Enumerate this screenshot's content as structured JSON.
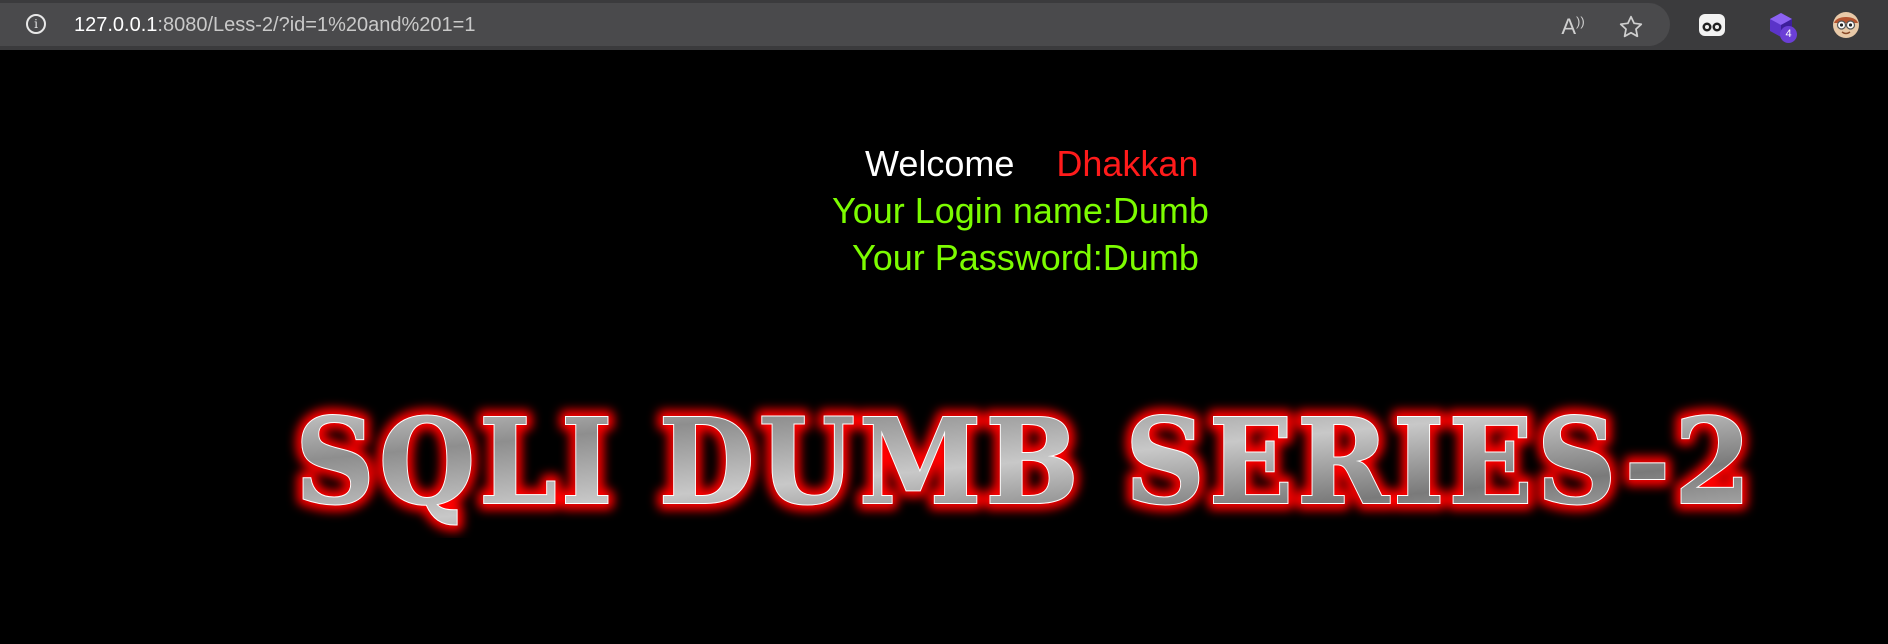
{
  "browser": {
    "url_host": "127.0.0.1",
    "url_rest": ":8080/Less-2/?id=1%20and%201=1",
    "icons": [
      "info-icon",
      "read-aloud-icon",
      "star-icon",
      "extension-glasses-icon",
      "extension-cube-icon",
      "profile-face-icon"
    ],
    "extension_badge": "4"
  },
  "page": {
    "welcome_word": "Welcome",
    "welcome_name": "Dhakkan",
    "login_line": "Your Login name:Dumb",
    "password_line": "Your Password:Dumb",
    "banner_text": "SQLI DUMB SERIES-2"
  },
  "colors": {
    "background": "#000000",
    "welcome": "#ffffff",
    "name": "#ff1b1b",
    "credentials": "#7cfc00",
    "banner_glow": "#ff0000"
  }
}
